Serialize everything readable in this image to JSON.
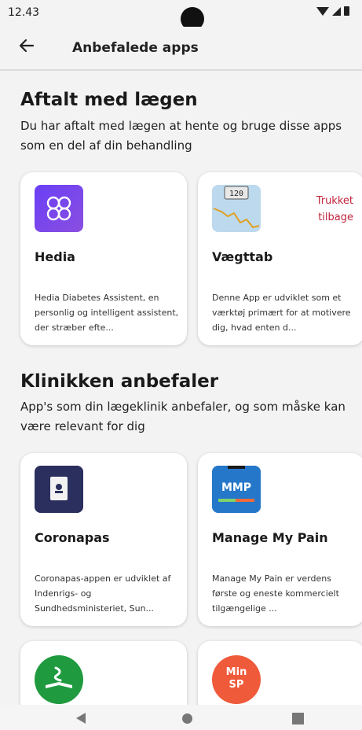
{
  "status": {
    "time": "12.43"
  },
  "header": {
    "title": "Anbefalede apps"
  },
  "sections": [
    {
      "title": "Aftalt med lægen",
      "description": "Du har aftalt med lægen at hente og bruge disse apps som en del af din behandling",
      "apps": [
        {
          "name": "Hedia",
          "description": "Hedia Diabetes Assistent, en personlig og intelligent assistent, der stræber efte...",
          "icon": "hedia-logo-icon"
        },
        {
          "name": "Vægttab",
          "description": "Denne App er udviklet som et værktøj primært for at motivere dig, hvad enten d...",
          "icon": "scale-chart-icon",
          "status": "Trukket tilbage"
        }
      ]
    },
    {
      "title": "Klinikken anbefaler",
      "description": "App's som din lægeklinik anbefaler, og som måske kan være relevant for dig",
      "apps": [
        {
          "name": "Coronapas",
          "description": "Coronapas-appen er udviklet af Indenrigs- og Sundhedsministeriet, Sun...",
          "icon": "passport-icon"
        },
        {
          "name": "Manage My Pain",
          "description": "Manage My Pain er verdens første og eneste kommercielt tilgængelige ...",
          "icon": "mmp-logo-icon",
          "icon_text": "MMP"
        },
        {
          "icon": "green-book-logo-icon"
        },
        {
          "icon": "min-sp-logo-icon",
          "icon_text": "Min SP"
        }
      ]
    }
  ],
  "colors": {
    "accent_withdrawn": "#c0233b",
    "background": "#f3f3f3",
    "card": "#ffffff"
  }
}
